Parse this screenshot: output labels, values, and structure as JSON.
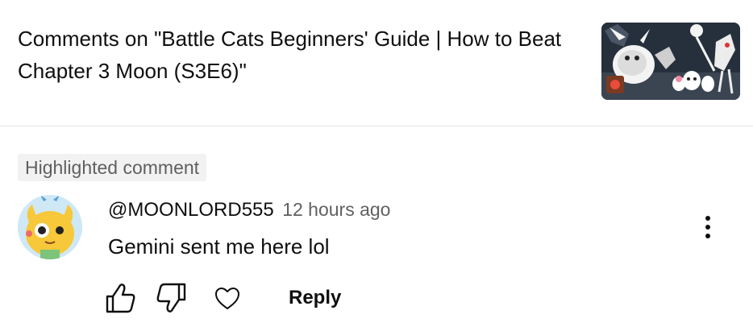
{
  "header": {
    "title": "Comments on \"Battle Cats Beginners' Guide | How to Beat Chapter 3 Moon (S3E6)\""
  },
  "badge": {
    "label": "Highlighted comment"
  },
  "comment": {
    "author": "@MOONLORD555",
    "time": "12 hours ago",
    "text": "Gemini sent me here lol"
  },
  "actions": {
    "reply_label": "Reply",
    "icons": [
      "thumbs-up-icon",
      "thumbs-down-icon",
      "heart-icon",
      "more-vert-icon"
    ]
  },
  "colors": {
    "text_primary": "#0f0f0f",
    "text_secondary": "#606060",
    "badge_bg": "#f2f2f2",
    "divider": "#e5e5e5"
  }
}
